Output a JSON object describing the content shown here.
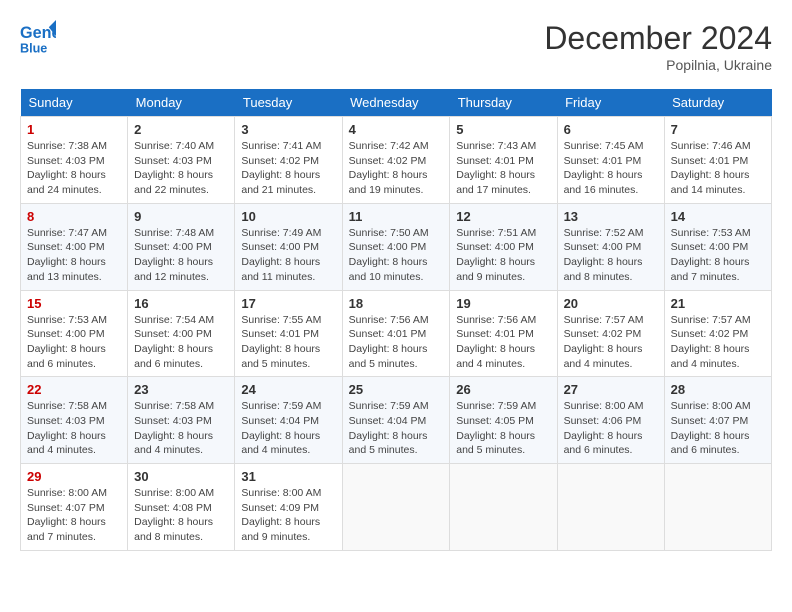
{
  "header": {
    "logo_line1": "General",
    "logo_line2": "Blue",
    "month": "December 2024",
    "location": "Popilnia, Ukraine"
  },
  "weekdays": [
    "Sunday",
    "Monday",
    "Tuesday",
    "Wednesday",
    "Thursday",
    "Friday",
    "Saturday"
  ],
  "weeks": [
    [
      {
        "day": "1",
        "info": "Sunrise: 7:38 AM\nSunset: 4:03 PM\nDaylight: 8 hours\nand 24 minutes."
      },
      {
        "day": "2",
        "info": "Sunrise: 7:40 AM\nSunset: 4:03 PM\nDaylight: 8 hours\nand 22 minutes."
      },
      {
        "day": "3",
        "info": "Sunrise: 7:41 AM\nSunset: 4:02 PM\nDaylight: 8 hours\nand 21 minutes."
      },
      {
        "day": "4",
        "info": "Sunrise: 7:42 AM\nSunset: 4:02 PM\nDaylight: 8 hours\nand 19 minutes."
      },
      {
        "day": "5",
        "info": "Sunrise: 7:43 AM\nSunset: 4:01 PM\nDaylight: 8 hours\nand 17 minutes."
      },
      {
        "day": "6",
        "info": "Sunrise: 7:45 AM\nSunset: 4:01 PM\nDaylight: 8 hours\nand 16 minutes."
      },
      {
        "day": "7",
        "info": "Sunrise: 7:46 AM\nSunset: 4:01 PM\nDaylight: 8 hours\nand 14 minutes."
      }
    ],
    [
      {
        "day": "8",
        "info": "Sunrise: 7:47 AM\nSunset: 4:00 PM\nDaylight: 8 hours\nand 13 minutes."
      },
      {
        "day": "9",
        "info": "Sunrise: 7:48 AM\nSunset: 4:00 PM\nDaylight: 8 hours\nand 12 minutes."
      },
      {
        "day": "10",
        "info": "Sunrise: 7:49 AM\nSunset: 4:00 PM\nDaylight: 8 hours\nand 11 minutes."
      },
      {
        "day": "11",
        "info": "Sunrise: 7:50 AM\nSunset: 4:00 PM\nDaylight: 8 hours\nand 10 minutes."
      },
      {
        "day": "12",
        "info": "Sunrise: 7:51 AM\nSunset: 4:00 PM\nDaylight: 8 hours\nand 9 minutes."
      },
      {
        "day": "13",
        "info": "Sunrise: 7:52 AM\nSunset: 4:00 PM\nDaylight: 8 hours\nand 8 minutes."
      },
      {
        "day": "14",
        "info": "Sunrise: 7:53 AM\nSunset: 4:00 PM\nDaylight: 8 hours\nand 7 minutes."
      }
    ],
    [
      {
        "day": "15",
        "info": "Sunrise: 7:53 AM\nSunset: 4:00 PM\nDaylight: 8 hours\nand 6 minutes."
      },
      {
        "day": "16",
        "info": "Sunrise: 7:54 AM\nSunset: 4:00 PM\nDaylight: 8 hours\nand 6 minutes."
      },
      {
        "day": "17",
        "info": "Sunrise: 7:55 AM\nSunset: 4:01 PM\nDaylight: 8 hours\nand 5 minutes."
      },
      {
        "day": "18",
        "info": "Sunrise: 7:56 AM\nSunset: 4:01 PM\nDaylight: 8 hours\nand 5 minutes."
      },
      {
        "day": "19",
        "info": "Sunrise: 7:56 AM\nSunset: 4:01 PM\nDaylight: 8 hours\nand 4 minutes."
      },
      {
        "day": "20",
        "info": "Sunrise: 7:57 AM\nSunset: 4:02 PM\nDaylight: 8 hours\nand 4 minutes."
      },
      {
        "day": "21",
        "info": "Sunrise: 7:57 AM\nSunset: 4:02 PM\nDaylight: 8 hours\nand 4 minutes."
      }
    ],
    [
      {
        "day": "22",
        "info": "Sunrise: 7:58 AM\nSunset: 4:03 PM\nDaylight: 8 hours\nand 4 minutes."
      },
      {
        "day": "23",
        "info": "Sunrise: 7:58 AM\nSunset: 4:03 PM\nDaylight: 8 hours\nand 4 minutes."
      },
      {
        "day": "24",
        "info": "Sunrise: 7:59 AM\nSunset: 4:04 PM\nDaylight: 8 hours\nand 4 minutes."
      },
      {
        "day": "25",
        "info": "Sunrise: 7:59 AM\nSunset: 4:04 PM\nDaylight: 8 hours\nand 5 minutes."
      },
      {
        "day": "26",
        "info": "Sunrise: 7:59 AM\nSunset: 4:05 PM\nDaylight: 8 hours\nand 5 minutes."
      },
      {
        "day": "27",
        "info": "Sunrise: 8:00 AM\nSunset: 4:06 PM\nDaylight: 8 hours\nand 6 minutes."
      },
      {
        "day": "28",
        "info": "Sunrise: 8:00 AM\nSunset: 4:07 PM\nDaylight: 8 hours\nand 6 minutes."
      }
    ],
    [
      {
        "day": "29",
        "info": "Sunrise: 8:00 AM\nSunset: 4:07 PM\nDaylight: 8 hours\nand 7 minutes."
      },
      {
        "day": "30",
        "info": "Sunrise: 8:00 AM\nSunset: 4:08 PM\nDaylight: 8 hours\nand 8 minutes."
      },
      {
        "day": "31",
        "info": "Sunrise: 8:00 AM\nSunset: 4:09 PM\nDaylight: 8 hours\nand 9 minutes."
      },
      null,
      null,
      null,
      null
    ]
  ]
}
